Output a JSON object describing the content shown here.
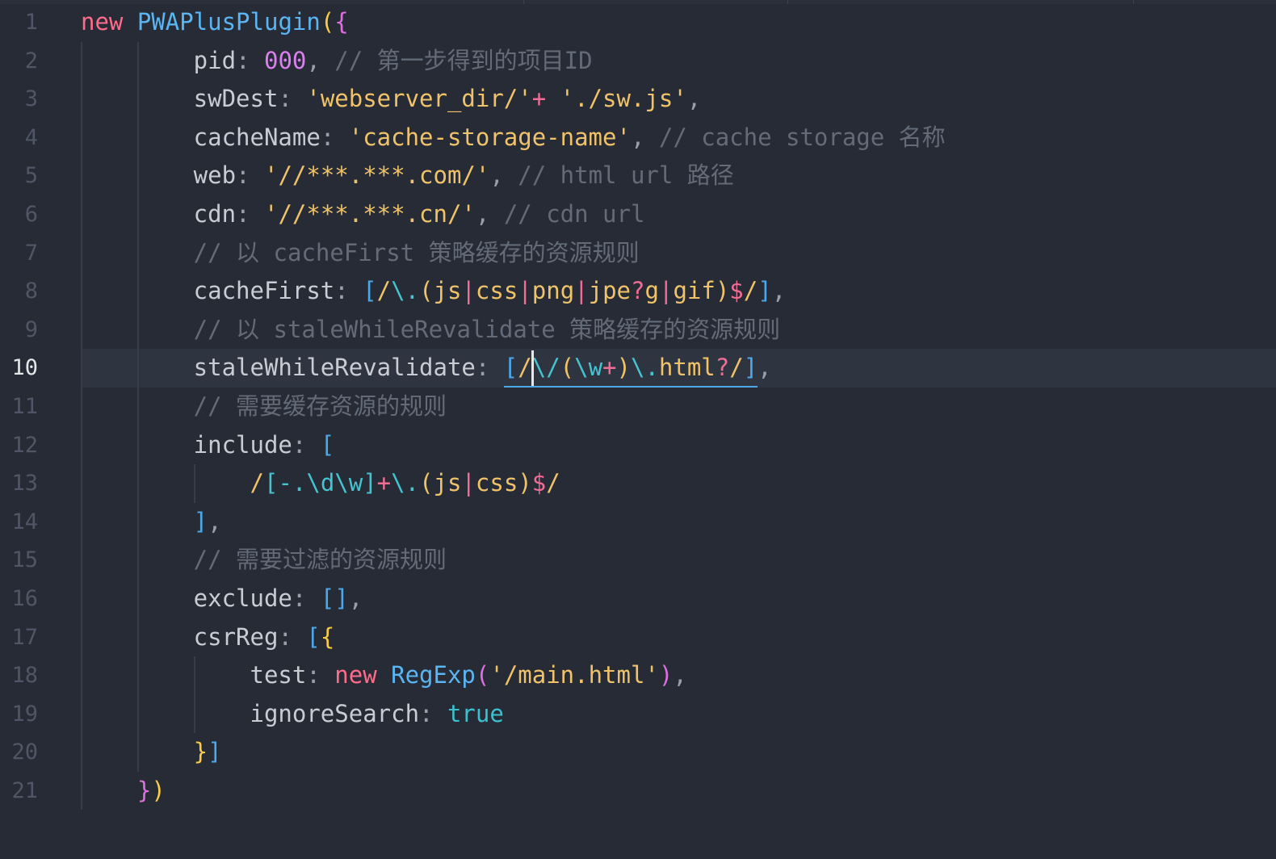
{
  "editor": {
    "active_line": 10,
    "cursor": {
      "line": 10,
      "column": 33
    },
    "highlight_underline": {
      "line": 10,
      "from_column": 31,
      "to_column": 48
    },
    "colors": {
      "background": "#262b35",
      "active_line": "#2f3540",
      "line_number": "#4f5665",
      "line_number_active": "#e4e6ea",
      "indent_guide": "#373d48",
      "cursor": "#e8e8e8",
      "underline": "#4da8e8"
    },
    "lines": [
      {
        "number": "1",
        "tokens": [
          [
            "new ",
            "#ff6b8b"
          ],
          [
            "PWAPlusPlugin",
            "#5ab5f2"
          ],
          [
            "(",
            "#f8cb45"
          ],
          [
            "{",
            "#df6fe0"
          ]
        ]
      },
      {
        "number": "2",
        "tokens": [
          [
            "        pid",
            "#c9ccd3"
          ],
          [
            ": ",
            "#9aa0aa"
          ],
          [
            "000",
            "#da80ef"
          ],
          [
            ", ",
            "#9aa0aa"
          ],
          [
            "// 第一步得到的项目ID",
            "#646b78"
          ]
        ]
      },
      {
        "number": "3",
        "tokens": [
          [
            "        swDest",
            "#c9ccd3"
          ],
          [
            ": ",
            "#9aa0aa"
          ],
          [
            "'webserver_dir/'",
            "#f0c36a"
          ],
          [
            "+ ",
            "#f26d95"
          ],
          [
            "'./sw.js'",
            "#f0c36a"
          ],
          [
            ",",
            "#9aa0aa"
          ]
        ]
      },
      {
        "number": "4",
        "tokens": [
          [
            "        cacheName",
            "#c9ccd3"
          ],
          [
            ": ",
            "#9aa0aa"
          ],
          [
            "'cache-storage-name'",
            "#f0c36a"
          ],
          [
            ", ",
            "#9aa0aa"
          ],
          [
            "// cache storage 名称",
            "#646b78"
          ]
        ]
      },
      {
        "number": "5",
        "tokens": [
          [
            "        web",
            "#c9ccd3"
          ],
          [
            ": ",
            "#9aa0aa"
          ],
          [
            "'//***.***.com/'",
            "#f0c36a"
          ],
          [
            ", ",
            "#9aa0aa"
          ],
          [
            "// html url 路径",
            "#646b78"
          ]
        ]
      },
      {
        "number": "6",
        "tokens": [
          [
            "        cdn",
            "#c9ccd3"
          ],
          [
            ": ",
            "#9aa0aa"
          ],
          [
            "'//***.***.cn/'",
            "#f0c36a"
          ],
          [
            ", ",
            "#9aa0aa"
          ],
          [
            "// cdn url",
            "#646b78"
          ]
        ]
      },
      {
        "number": "7",
        "tokens": [
          [
            "        // 以 cacheFirst 策略缓存的资源规则",
            "#646b78"
          ]
        ]
      },
      {
        "number": "8",
        "tokens": [
          [
            "        cacheFirst",
            "#c9ccd3"
          ],
          [
            ": ",
            "#9aa0aa"
          ],
          [
            "[",
            "#4ca8ea"
          ],
          [
            "/",
            "#f0c36a"
          ],
          [
            "\\.",
            "#45c3d0"
          ],
          [
            "(js",
            "#f0c36a"
          ],
          [
            "|",
            "#f26d95"
          ],
          [
            "css",
            "#f0c36a"
          ],
          [
            "|",
            "#f26d95"
          ],
          [
            "png",
            "#f0c36a"
          ],
          [
            "|",
            "#f26d95"
          ],
          [
            "jpe",
            "#f0c36a"
          ],
          [
            "?",
            "#f26d95"
          ],
          [
            "g",
            "#f0c36a"
          ],
          [
            "|",
            "#f26d95"
          ],
          [
            "gif)",
            "#f0c36a"
          ],
          [
            "$",
            "#f26d95"
          ],
          [
            "/",
            "#f0c36a"
          ],
          [
            "]",
            "#4ca8ea"
          ],
          [
            ",",
            "#9aa0aa"
          ]
        ]
      },
      {
        "number": "9",
        "tokens": [
          [
            "        // 以 staleWhileRevalidate 策略缓存的资源规则",
            "#646b78"
          ]
        ]
      },
      {
        "number": "10",
        "tokens": [
          [
            "        staleWhileRevalidate",
            "#c9ccd3"
          ],
          [
            ": ",
            "#9aa0aa"
          ],
          [
            "[",
            "#4ca8ea"
          ],
          [
            "/",
            "#f0c36a"
          ],
          [
            "\\/",
            "#45c3d0"
          ],
          [
            "(",
            "#f0c36a"
          ],
          [
            "\\w",
            "#45c3d0"
          ],
          [
            "+",
            "#f26d95"
          ],
          [
            ")",
            "#f0c36a"
          ],
          [
            "\\.",
            "#45c3d0"
          ],
          [
            "html",
            "#f0c36a"
          ],
          [
            "?",
            "#f26d95"
          ],
          [
            "/",
            "#f0c36a"
          ],
          [
            "]",
            "#4ca8ea"
          ],
          [
            ",",
            "#9aa0aa"
          ]
        ]
      },
      {
        "number": "11",
        "tokens": [
          [
            "        // 需要缓存资源的规则",
            "#646b78"
          ]
        ]
      },
      {
        "number": "12",
        "tokens": [
          [
            "        include",
            "#c9ccd3"
          ],
          [
            ": ",
            "#9aa0aa"
          ],
          [
            "[",
            "#4ca8ea"
          ]
        ]
      },
      {
        "number": "13",
        "tokens": [
          [
            "            /",
            "#f0c36a"
          ],
          [
            "[-.\\d\\w]",
            "#45c3d0"
          ],
          [
            "+",
            "#f26d95"
          ],
          [
            "\\.",
            "#45c3d0"
          ],
          [
            "(js",
            "#f0c36a"
          ],
          [
            "|",
            "#f26d95"
          ],
          [
            "css)",
            "#f0c36a"
          ],
          [
            "$",
            "#f26d95"
          ],
          [
            "/",
            "#f0c36a"
          ]
        ]
      },
      {
        "number": "14",
        "tokens": [
          [
            "        ]",
            "#4ca8ea"
          ],
          [
            ",",
            "#9aa0aa"
          ]
        ]
      },
      {
        "number": "15",
        "tokens": [
          [
            "        // 需要过滤的资源规则",
            "#646b78"
          ]
        ]
      },
      {
        "number": "16",
        "tokens": [
          [
            "        exclude",
            "#c9ccd3"
          ],
          [
            ": ",
            "#9aa0aa"
          ],
          [
            "[]",
            "#4ca8ea"
          ],
          [
            ",",
            "#9aa0aa"
          ]
        ]
      },
      {
        "number": "17",
        "tokens": [
          [
            "        csrReg",
            "#c9ccd3"
          ],
          [
            ": ",
            "#9aa0aa"
          ],
          [
            "[",
            "#4ca8ea"
          ],
          [
            "{",
            "#f8cb45"
          ]
        ]
      },
      {
        "number": "18",
        "tokens": [
          [
            "            test",
            "#c9ccd3"
          ],
          [
            ": ",
            "#9aa0aa"
          ],
          [
            "new ",
            "#ff6b8b"
          ],
          [
            "RegExp",
            "#5ab5f2"
          ],
          [
            "(",
            "#df6fe0"
          ],
          [
            "'/main.html'",
            "#f0c36a"
          ],
          [
            ")",
            "#df6fe0"
          ],
          [
            ",",
            "#9aa0aa"
          ]
        ]
      },
      {
        "number": "19",
        "tokens": [
          [
            "            ignoreSearch",
            "#c9ccd3"
          ],
          [
            ": ",
            "#9aa0aa"
          ],
          [
            "true",
            "#3cc0cf"
          ]
        ]
      },
      {
        "number": "20",
        "tokens": [
          [
            "        }",
            "#f8cb45"
          ],
          [
            "]",
            "#4ca8ea"
          ]
        ]
      },
      {
        "number": "21",
        "tokens": [
          [
            "    }",
            "#df6fe0"
          ],
          [
            ")",
            "#f8cb45"
          ]
        ]
      }
    ]
  }
}
